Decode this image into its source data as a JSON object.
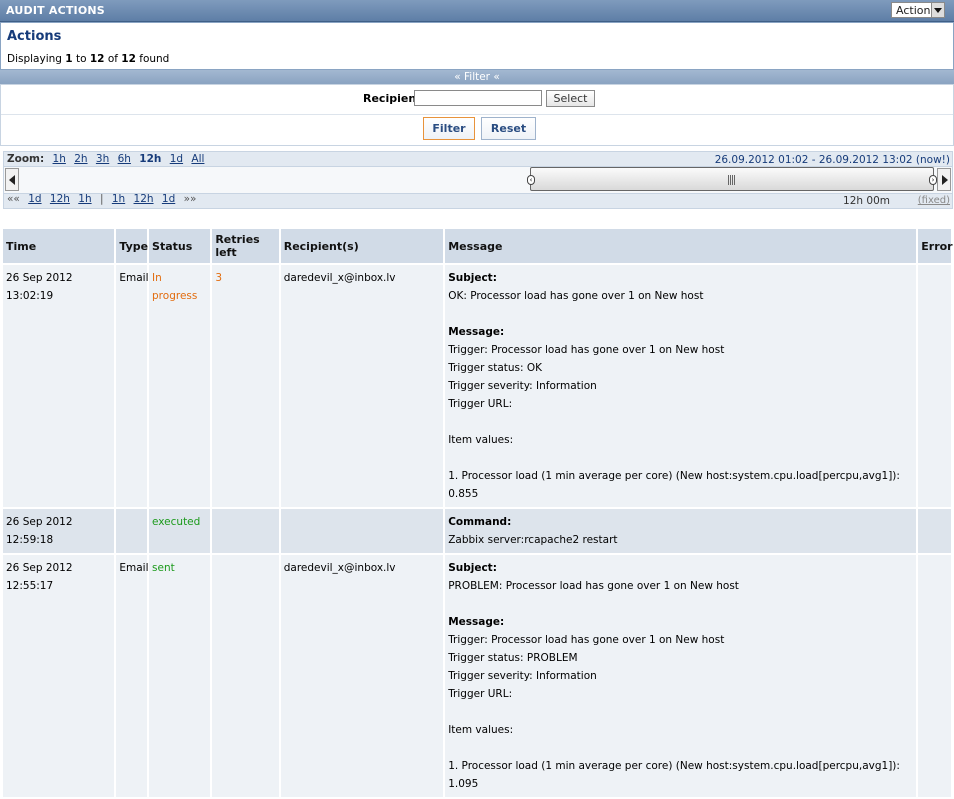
{
  "header": {
    "title": "AUDIT ACTIONS",
    "select_value": "Actions"
  },
  "summary": {
    "heading": "Actions",
    "prefix": "Displaying",
    "from": "1",
    "to_word": "to",
    "to": "12",
    "of_word": "of",
    "total": "12",
    "suffix": "found"
  },
  "filter": {
    "bar_label": "« Filter «",
    "recipient_label": "Recipient",
    "recipient_value": "",
    "select_button": "Select",
    "filter_button": "Filter",
    "reset_button": "Reset"
  },
  "timeline": {
    "zoom_label": "Zoom:",
    "zoom_options": [
      "1h",
      "2h",
      "3h",
      "6h",
      "12h",
      "1d",
      "All"
    ],
    "zoom_active": "12h",
    "period": "26.09.2012 01:02  -  26.09.2012 13:02 (now!)",
    "nav_left_sym": "««",
    "nav_left": [
      "1d",
      "12h",
      "1h"
    ],
    "nav_sep": "|",
    "nav_right": [
      "1h",
      "12h",
      "1d"
    ],
    "nav_right_sym": "»»",
    "duration": "12h 00m",
    "fixed": "(fixed)"
  },
  "table": {
    "columns": [
      "Time",
      "Type",
      "Status",
      "Retries left",
      "Recipient(s)",
      "Message",
      "Error"
    ],
    "rows": [
      {
        "time": "26 Sep 2012 13:02:19",
        "type": "Email",
        "status": "In progress",
        "status_color": "#e26c0e",
        "retries": "3",
        "recipient": "daredevil_x@inbox.lv",
        "message": [
          {
            "text": "Subject:",
            "bold": true
          },
          {
            "text": "OK: Processor load has gone over 1 on New host"
          },
          {
            "text": ""
          },
          {
            "text": "Message:",
            "bold": true
          },
          {
            "text": "Trigger: Processor load has gone over 1 on New host"
          },
          {
            "text": "Trigger status: OK"
          },
          {
            "text": "Trigger severity: Information"
          },
          {
            "text": "Trigger URL:"
          },
          {
            "text": ""
          },
          {
            "text": "Item values:"
          },
          {
            "text": ""
          },
          {
            "text": "1. Processor load (1 min average per core) (New host:system.cpu.load[percpu,avg1]): 0.855"
          }
        ],
        "error": ""
      },
      {
        "time": "26 Sep 2012 12:59:18",
        "type": "",
        "status": "executed",
        "status_color": "#1c9a1c",
        "retries": "",
        "recipient": "",
        "message": [
          {
            "text": "Command:",
            "bold": true
          },
          {
            "text": "Zabbix server:rcapache2 restart"
          }
        ],
        "error": ""
      },
      {
        "time": "26 Sep 2012 12:55:17",
        "type": "Email",
        "status": "sent",
        "status_color": "#1c9a1c",
        "retries": "",
        "recipient": "daredevil_x@inbox.lv",
        "message": [
          {
            "text": "Subject:",
            "bold": true
          },
          {
            "text": "PROBLEM: Processor load has gone over 1 on New host"
          },
          {
            "text": ""
          },
          {
            "text": "Message:",
            "bold": true
          },
          {
            "text": "Trigger: Processor load has gone over 1 on New host"
          },
          {
            "text": "Trigger status: PROBLEM"
          },
          {
            "text": "Trigger severity: Information"
          },
          {
            "text": "Trigger URL:"
          },
          {
            "text": ""
          },
          {
            "text": "Item values:"
          },
          {
            "text": ""
          },
          {
            "text": "1. Processor load (1 min average per core) (New host:system.cpu.load[percpu,avg1]): 1.095"
          }
        ],
        "error": ""
      }
    ]
  }
}
